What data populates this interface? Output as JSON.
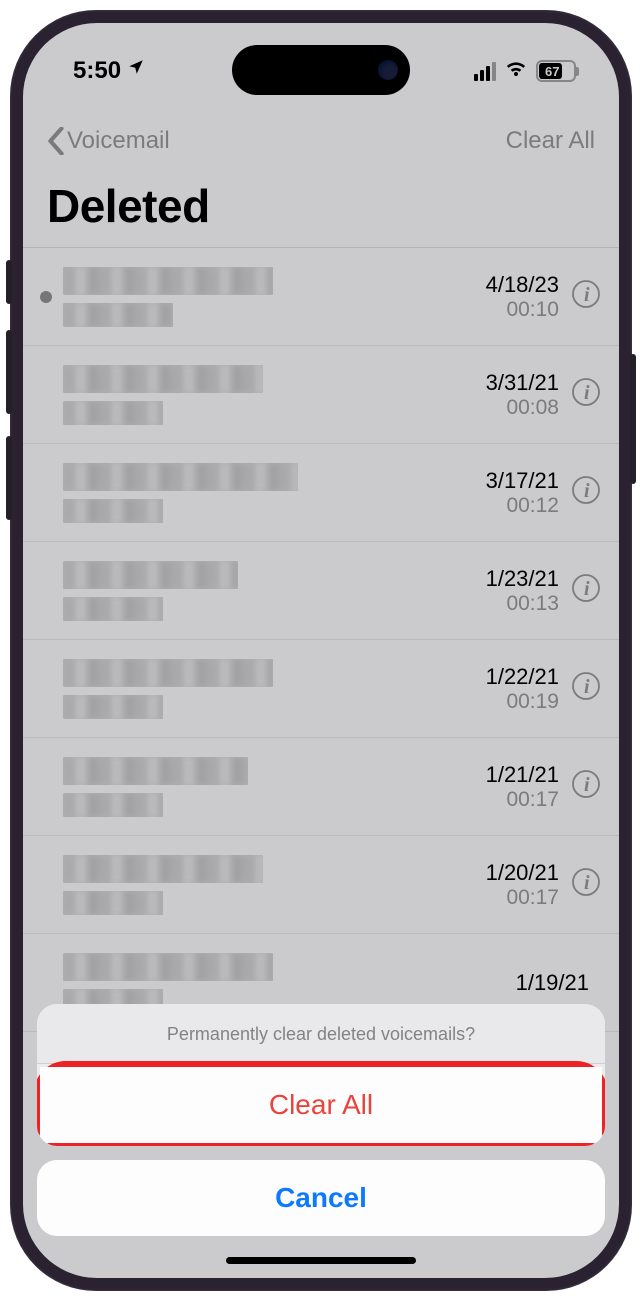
{
  "status": {
    "time": "5:50",
    "battery_pct": "67"
  },
  "nav": {
    "back_label": "Voicemail",
    "right_label": "Clear All"
  },
  "title": "Deleted",
  "rows": [
    {
      "unread": true,
      "w1": 210,
      "w2": 110,
      "date": "4/18/23",
      "duration": "00:10"
    },
    {
      "unread": false,
      "w1": 200,
      "w2": 100,
      "date": "3/31/21",
      "duration": "00:08"
    },
    {
      "unread": false,
      "w1": 235,
      "w2": 100,
      "date": "3/17/21",
      "duration": "00:12"
    },
    {
      "unread": false,
      "w1": 175,
      "w2": 100,
      "date": "1/23/21",
      "duration": "00:13"
    },
    {
      "unread": false,
      "w1": 210,
      "w2": 100,
      "date": "1/22/21",
      "duration": "00:19"
    },
    {
      "unread": false,
      "w1": 185,
      "w2": 100,
      "date": "1/21/21",
      "duration": "00:17"
    },
    {
      "unread": false,
      "w1": 200,
      "w2": 100,
      "date": "1/20/21",
      "duration": "00:17"
    },
    {
      "unread": false,
      "w1": 210,
      "w2": 100,
      "date": "1/19/21",
      "duration": ""
    }
  ],
  "sheet": {
    "message": "Permanently clear deleted voicemails?",
    "destructive_label": "Clear All",
    "cancel_label": "Cancel"
  }
}
